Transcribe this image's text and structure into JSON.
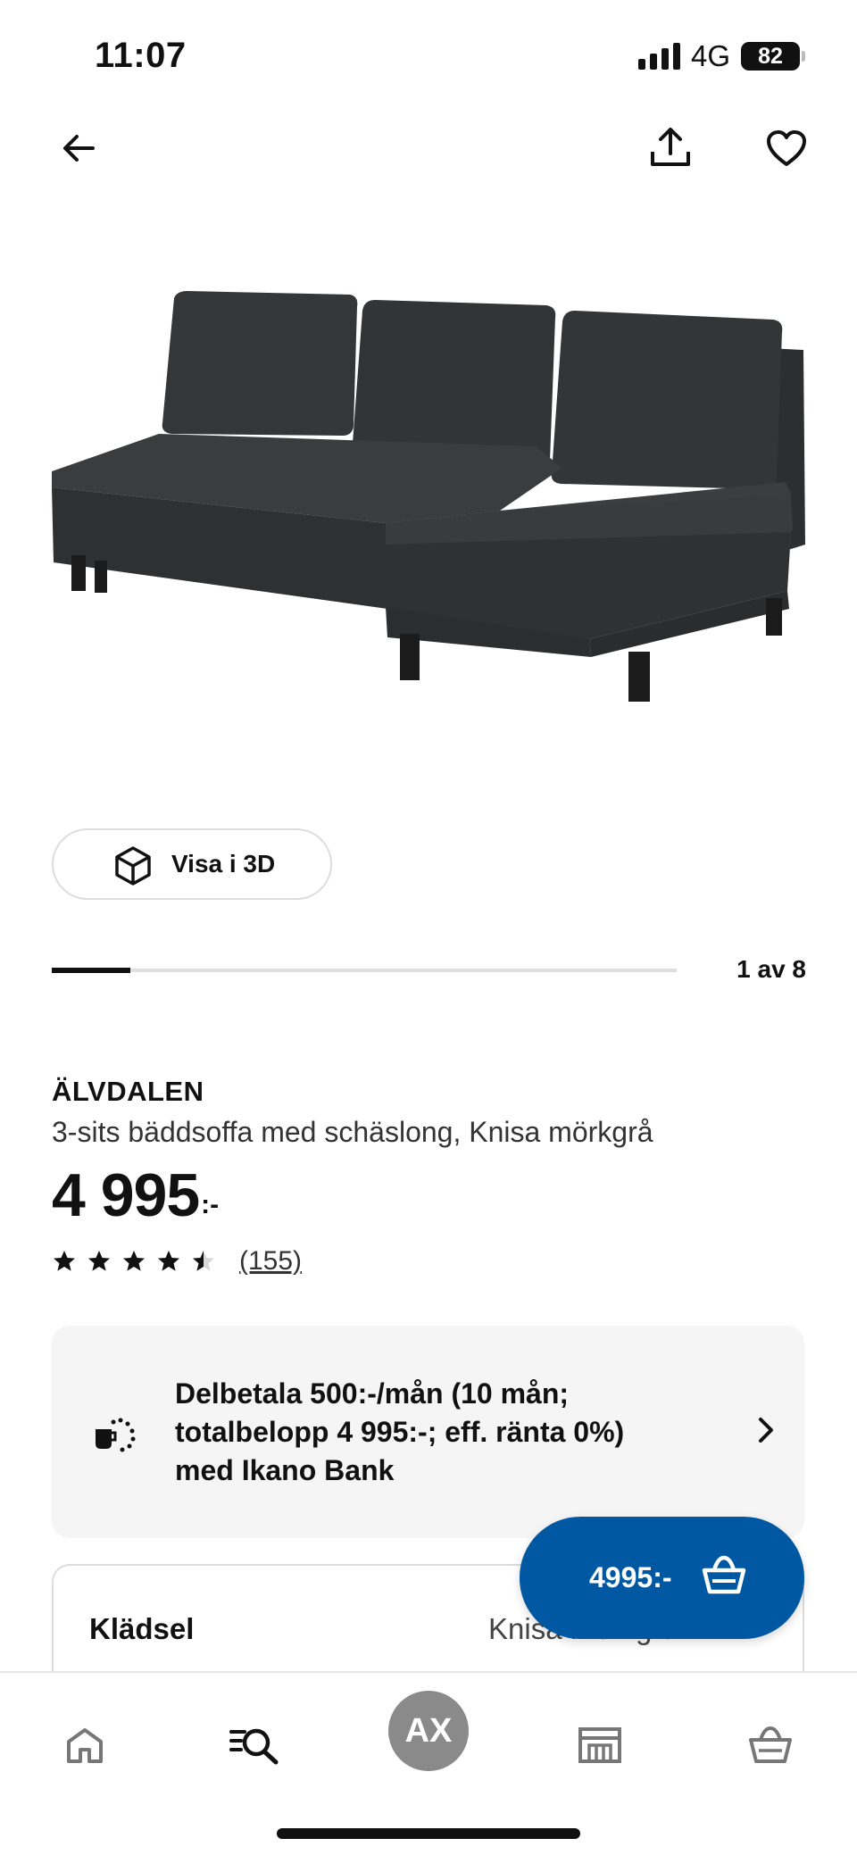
{
  "status_bar": {
    "time": "11:07",
    "network": "4G",
    "battery": "82",
    "signal_icon": "signal-bars-icon"
  },
  "nav": {
    "back_icon": "arrow-left-icon",
    "share_icon": "share-icon",
    "favorite_icon": "heart-icon"
  },
  "product": {
    "image_icon": "sofa-image",
    "view3d_label": "Visa i 3D",
    "carousel_count": "1 av 8",
    "carousel_progress": 0.125,
    "name": "ÄLVDALEN",
    "description": "3-sits bäddsoffa med schäslong, Knisa mörkgrå",
    "price": "4 995",
    "price_suffix": ":-",
    "rating": 4.5,
    "review_count": "(155)"
  },
  "finance": {
    "text": "Delbetala 500:-/mån (10 mån; totalbelopp 4 995:-; eff. ränta 0%) med Ikano Bank",
    "icon": "payment-installment-icon"
  },
  "fabric": {
    "label": "Klädsel",
    "value": "Knisa mörkgrå"
  },
  "cart_fab": {
    "price": "4995:-",
    "icon": "cart-icon",
    "color": "#0058a3"
  },
  "tab_bar": {
    "home_icon": "home-icon",
    "search_icon": "search-list-icon",
    "profile_initials": "AX",
    "store_icon": "store-icon",
    "cart_icon": "cart-icon"
  }
}
